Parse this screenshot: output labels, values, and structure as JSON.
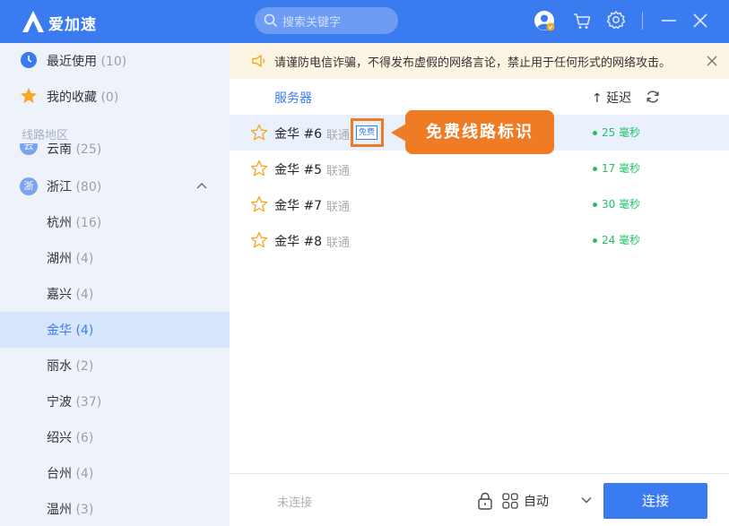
{
  "app": {
    "name": "爱加速"
  },
  "search": {
    "placeholder": "搜索关键字"
  },
  "sidebar": {
    "recent": {
      "label": "最近使用",
      "count": "(10)"
    },
    "favorites": {
      "label": "我的收藏",
      "count": "(0)"
    },
    "section": "线路地区",
    "prov_yunnan": {
      "badge": "云",
      "label": "云南",
      "count": "(25)"
    },
    "prov_zhejiang": {
      "badge": "浙",
      "label": "浙江",
      "count": "(80)"
    },
    "cities": [
      {
        "label": "杭州",
        "count": "(16)"
      },
      {
        "label": "湖州",
        "count": "(4)"
      },
      {
        "label": "嘉兴",
        "count": "(4)"
      },
      {
        "label": "金华",
        "count": "(4)"
      },
      {
        "label": "丽水",
        "count": "(2)"
      },
      {
        "label": "宁波",
        "count": "(37)"
      },
      {
        "label": "绍兴",
        "count": "(6)"
      },
      {
        "label": "台州",
        "count": "(4)"
      },
      {
        "label": "温州",
        "count": "(3)"
      }
    ],
    "active_city": "金华"
  },
  "notice": {
    "text": "请谨防电信诈骗，不得发布虚假的网络言论，禁止用于任何形式的网络攻击。"
  },
  "table": {
    "col_server": "服务器",
    "col_latency": "↑ 延迟",
    "rows": [
      {
        "name": "金华 #6",
        "isp": "联通",
        "latency": "25 毫秒",
        "free": "免费"
      },
      {
        "name": "金华 #5",
        "isp": "联通",
        "latency": "17 毫秒"
      },
      {
        "name": "金华 #7",
        "isp": "联通",
        "latency": "30 毫秒"
      },
      {
        "name": "金华 #8",
        "isp": "联通",
        "latency": "24 毫秒"
      }
    ]
  },
  "callout": {
    "text": "免费线路标识"
  },
  "bottom": {
    "status": "未连接",
    "mode": "自动",
    "connect": "连接"
  },
  "colors": {
    "brand": "#3a7bf0",
    "accent": "#f07b25",
    "latency": "#22c06a"
  }
}
